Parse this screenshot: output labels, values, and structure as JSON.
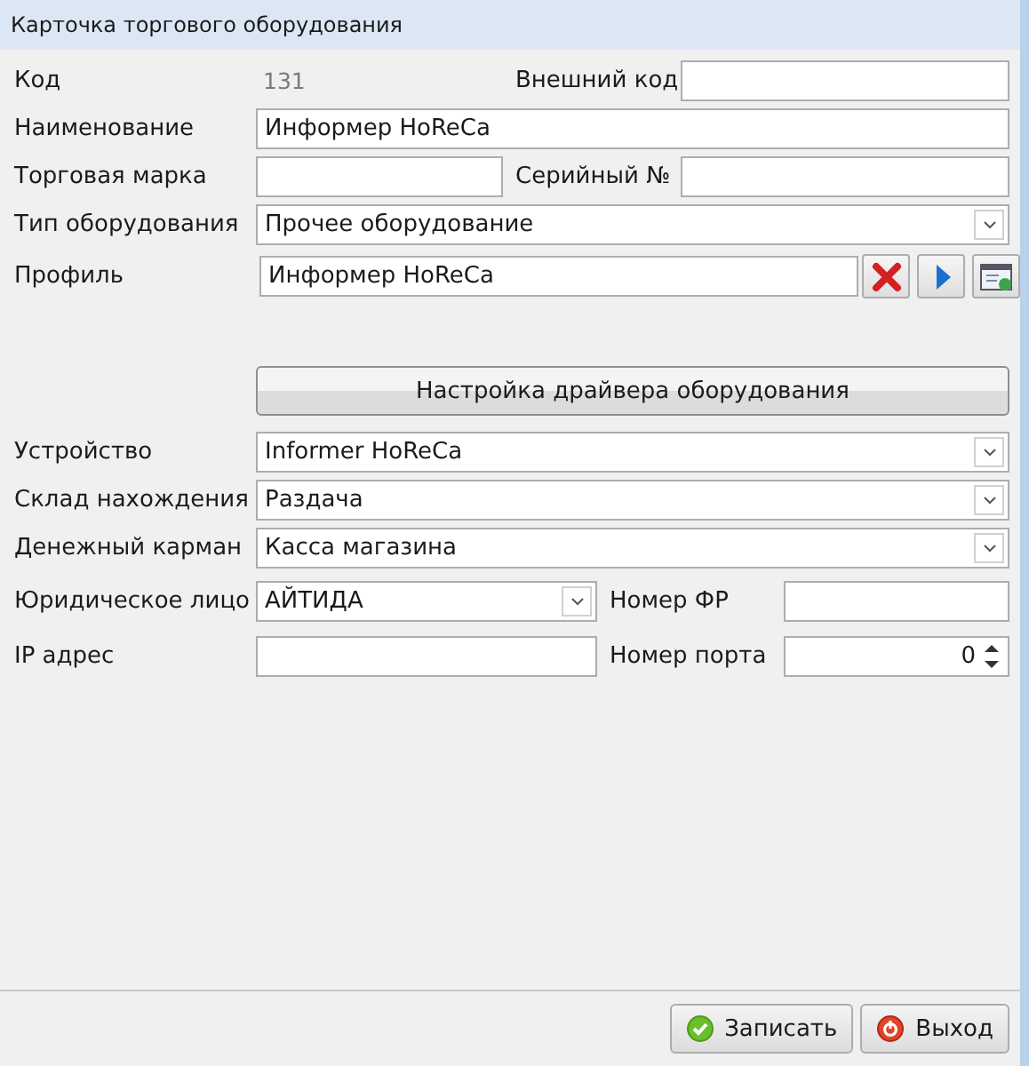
{
  "window": {
    "title": "Карточка торгового оборудования"
  },
  "rows": [
    {
      "kind": "split",
      "items": [
        {
          "kind": "label",
          "text": "Код"
        },
        {
          "kind": "readonly",
          "value": "131"
        },
        {
          "kind": "label",
          "text": "Внешний код"
        },
        {
          "kind": "input",
          "value": ""
        }
      ]
    },
    {
      "kind": "full",
      "items": [
        {
          "kind": "label",
          "text": "Наименование"
        },
        {
          "kind": "input",
          "value": "Информер HoReCa"
        }
      ]
    },
    {
      "kind": "split",
      "items": [
        {
          "kind": "label",
          "text": "Торговая марка"
        },
        {
          "kind": "input",
          "value": ""
        },
        {
          "kind": "label",
          "text": "Серийный №"
        },
        {
          "kind": "input",
          "value": ""
        }
      ]
    },
    {
      "kind": "full",
      "items": [
        {
          "kind": "label",
          "text": "Тип оборудования"
        },
        {
          "kind": "combo",
          "value": "Прочее оборудование"
        }
      ]
    },
    {
      "kind": "profile",
      "items": [
        {
          "kind": "label",
          "text": "Профиль"
        },
        {
          "kind": "input",
          "value": "Информер HoReCa"
        },
        {
          "kind": "clear"
        },
        {
          "kind": "play"
        },
        {
          "kind": "browse"
        }
      ]
    },
    {
      "kind": "button",
      "items": [
        {
          "kind": "button",
          "text": "Настройка драйвера оборудования"
        }
      ]
    },
    {
      "kind": "full",
      "items": [
        {
          "kind": "label",
          "text": "Устройство"
        },
        {
          "kind": "combo",
          "value": "Informer HoReCa"
        }
      ]
    },
    {
      "kind": "full",
      "items": [
        {
          "kind": "label",
          "text": "Склад нахождения"
        },
        {
          "kind": "combo",
          "value": "Раздача"
        }
      ]
    },
    {
      "kind": "full",
      "items": [
        {
          "kind": "label",
          "text": "Денежный карман"
        },
        {
          "kind": "combo",
          "value": "Касса магазина"
        }
      ]
    },
    {
      "kind": "half",
      "items": [
        {
          "kind": "label",
          "text": "Юридическое лицо"
        },
        {
          "kind": "combo",
          "value": "АЙТИДА"
        },
        {
          "kind": "label",
          "text": "Номер ФР"
        },
        {
          "kind": "input",
          "value": ""
        }
      ]
    },
    {
      "kind": "half",
      "items": [
        {
          "kind": "label",
          "text": "IP адрес"
        },
        {
          "kind": "input",
          "value": ""
        },
        {
          "kind": "label",
          "text": "Номер порта"
        },
        {
          "kind": "spin",
          "value": "0"
        }
      ]
    }
  ],
  "footer": [
    {
      "kind": "save",
      "label": "Записать"
    },
    {
      "kind": "exit",
      "label": "Выход"
    }
  ]
}
